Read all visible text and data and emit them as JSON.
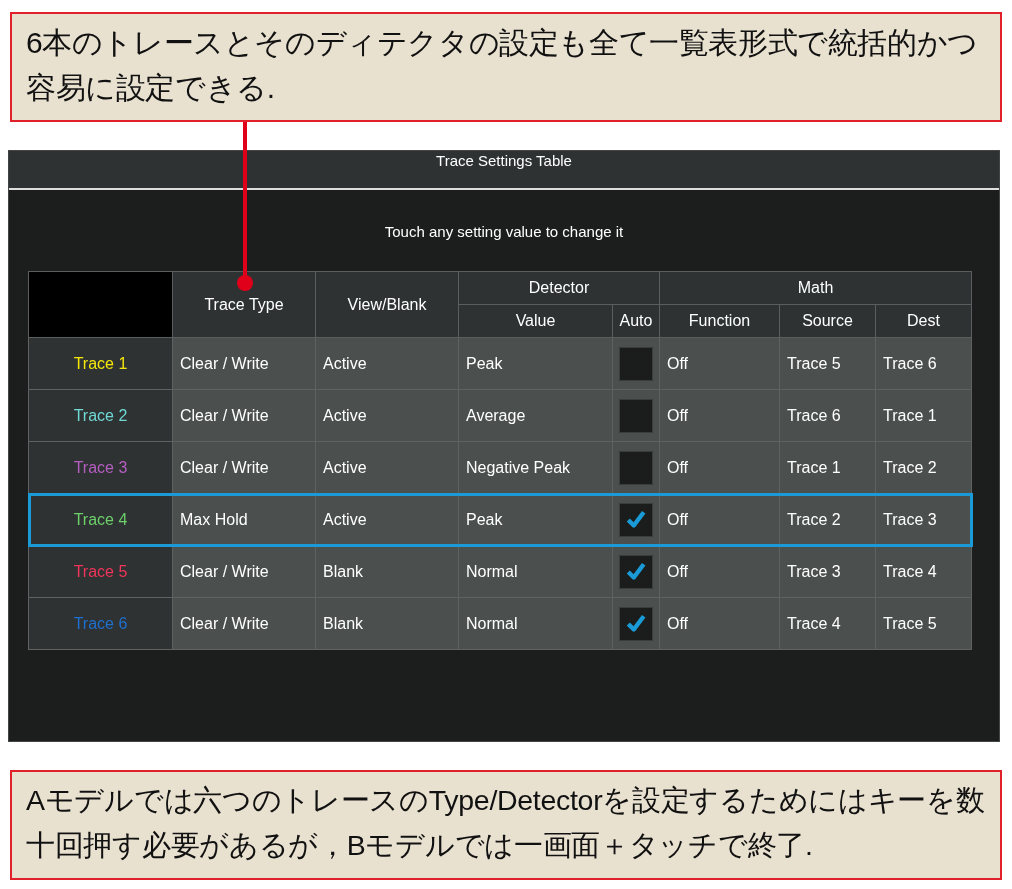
{
  "callout_top": "6本のトレースとそのディテクタの設定も全て一覧表形式で統括的かつ容易に設定できる.",
  "window": {
    "title": "Trace Settings Table",
    "instruction": "Touch any setting value to change it"
  },
  "table": {
    "columns": [
      "Trace Type",
      "View/Blank"
    ],
    "detector_group": "Detector",
    "detector_columns": [
      "Value",
      "Auto"
    ],
    "math_group": "Math",
    "math_columns": [
      "Function",
      "Source",
      "Dest"
    ],
    "rows": [
      {
        "trace": "Trace 1",
        "color": "#f5e60a",
        "selected": false,
        "type": "Clear / Write",
        "view": "Active",
        "detector": "Peak",
        "auto": false,
        "function": "Off",
        "source": "Trace 5",
        "dest": "Trace 6"
      },
      {
        "trace": "Trace 2",
        "color": "#6fd8d4",
        "selected": false,
        "type": "Clear / Write",
        "view": "Active",
        "detector": "Average",
        "auto": false,
        "function": "Off",
        "source": "Trace 6",
        "dest": "Trace 1"
      },
      {
        "trace": "Trace 3",
        "color": "#b45ec0",
        "selected": false,
        "type": "Clear / Write",
        "view": "Active",
        "detector": "Negative Peak",
        "auto": false,
        "function": "Off",
        "source": "Trace 1",
        "dest": "Trace 2"
      },
      {
        "trace": "Trace 4",
        "color": "#6ccf6a",
        "selected": true,
        "type": "Max Hold",
        "view": "Active",
        "detector": "Peak",
        "auto": true,
        "function": "Off",
        "source": "Trace 2",
        "dest": "Trace 3"
      },
      {
        "trace": "Trace 5",
        "color": "#f0345a",
        "selected": false,
        "type": "Clear / Write",
        "view": "Blank",
        "detector": "Normal",
        "auto": true,
        "function": "Off",
        "source": "Trace 3",
        "dest": "Trace 4"
      },
      {
        "trace": "Trace 6",
        "color": "#1f6fd0",
        "selected": false,
        "type": "Clear / Write",
        "view": "Blank",
        "detector": "Normal",
        "auto": true,
        "function": "Off",
        "source": "Trace 4",
        "dest": "Trace 5"
      }
    ]
  },
  "callout_bottom": "Aモデルでは六つのトレースのType/Detectorを設定するためにはキーを数十回押す必要があるが，Bモデルでは一画面＋タッチで終了."
}
